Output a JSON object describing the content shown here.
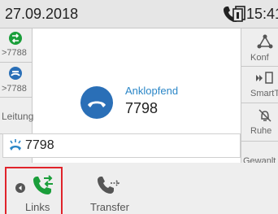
{
  "status_bar": {
    "date": "27.09.2018",
    "time": "15:41"
  },
  "left_keys": [
    {
      "label": ">7788",
      "icon": "call-switch-icon",
      "color": "#1a9e3a"
    },
    {
      "label": ">7788",
      "icon": "call-held-icon",
      "color": "#2a6fb7"
    },
    {
      "label": "Leitung"
    },
    {
      "label": ""
    }
  ],
  "right_keys": [
    {
      "label": "Konf",
      "icon": "conference-icon"
    },
    {
      "label": "SmartTr",
      "icon": "smart-transfer-icon"
    },
    {
      "label": "Ruhe",
      "icon": "do-not-disturb-icon"
    },
    {
      "label": "Gewanlt"
    }
  ],
  "call": {
    "status": "Anklopfend",
    "number": "7798",
    "icon": "hangup-icon",
    "accent": "#2a86c7"
  },
  "waiting_call": {
    "number": "7798",
    "icon": "ringing-icon"
  },
  "softkeys": [
    {
      "label": "Links",
      "icon": "call-switch-icon",
      "color": "#1a9e3a"
    },
    {
      "label": "Transfer",
      "icon": "transfer-icon"
    }
  ],
  "highlight_color": "#e0232b"
}
